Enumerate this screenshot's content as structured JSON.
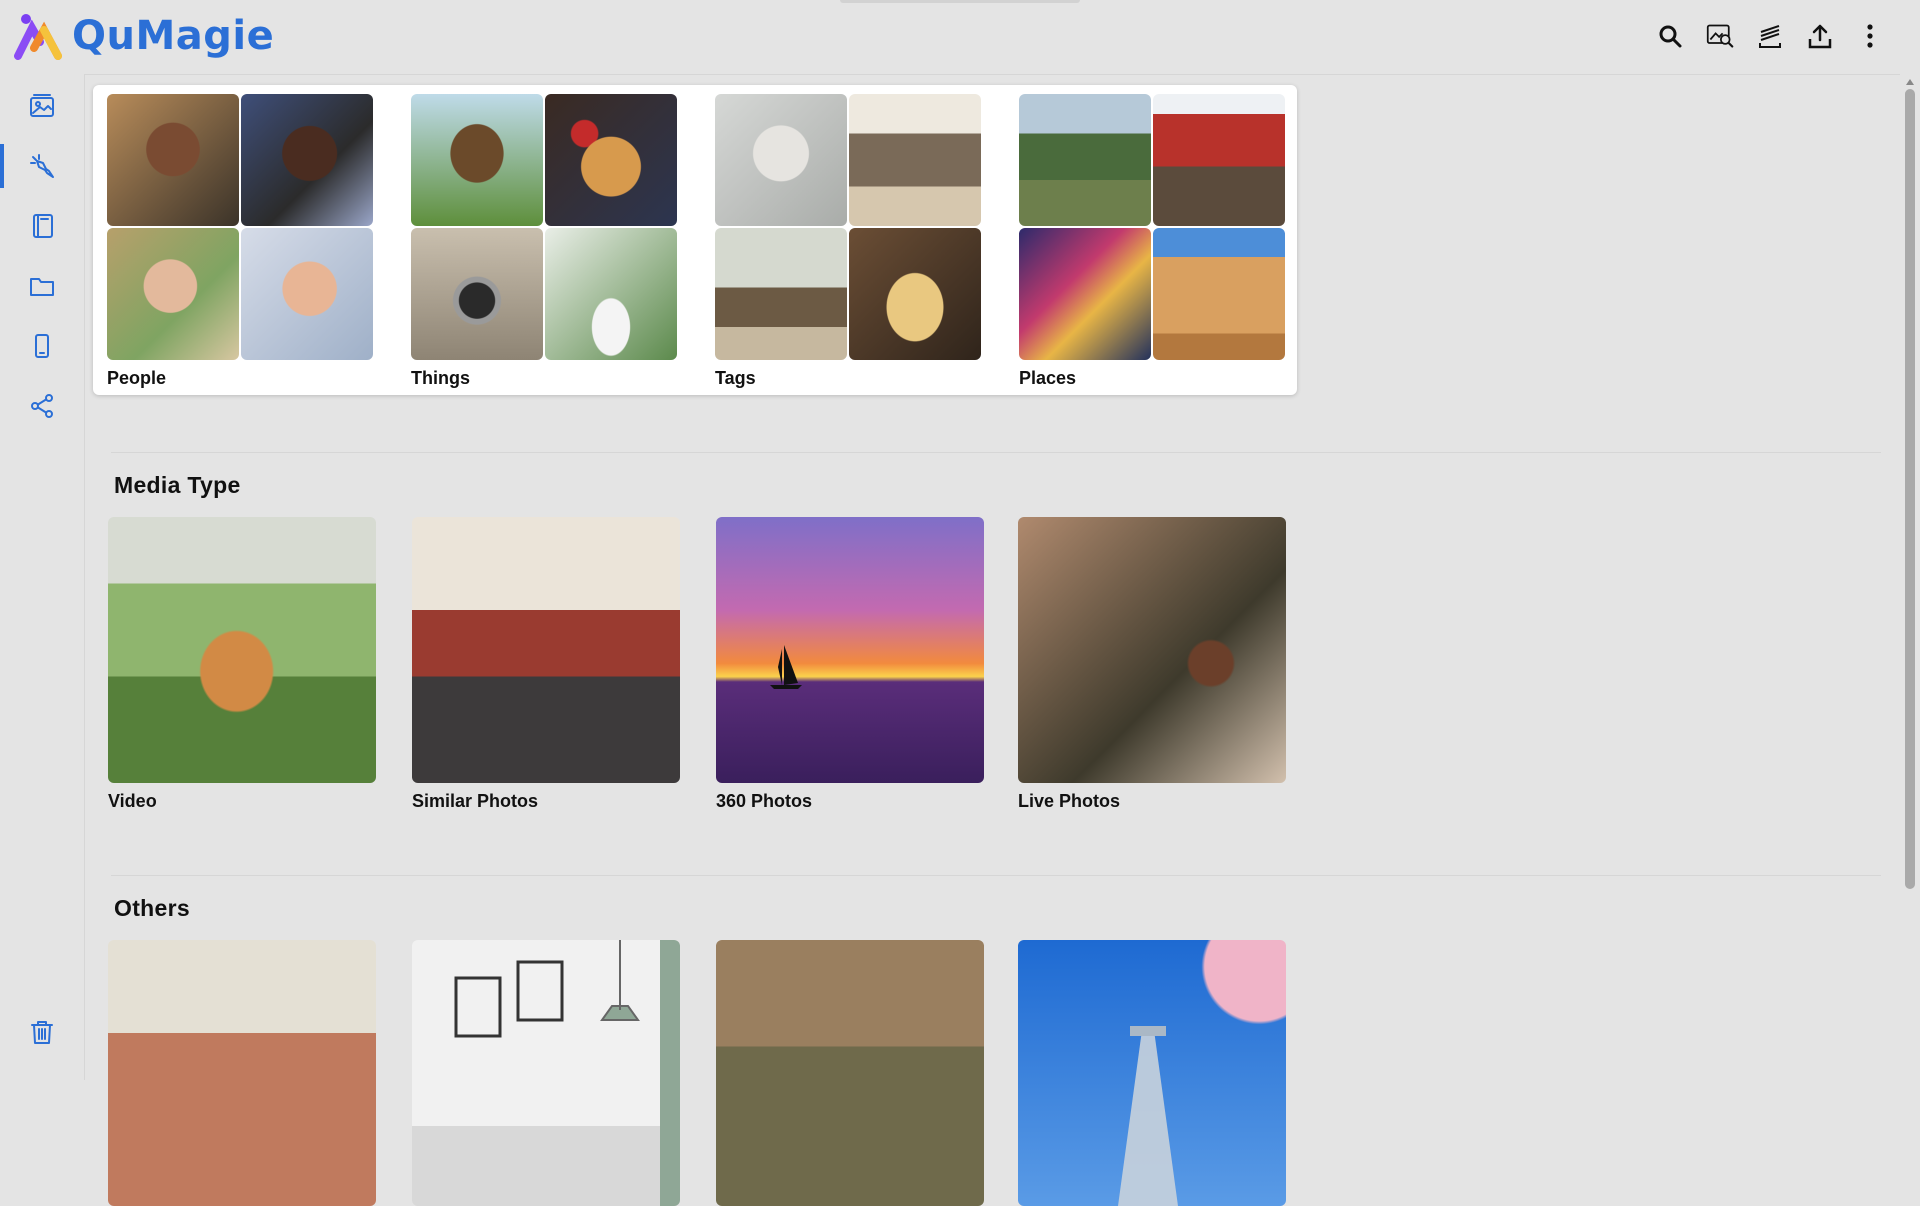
{
  "app": {
    "name": "QuMagie"
  },
  "top_actions": [
    {
      "icon": "search-icon"
    },
    {
      "icon": "image-search-icon"
    },
    {
      "icon": "stack-icon"
    },
    {
      "icon": "upload-icon"
    },
    {
      "icon": "more-vertical-icon"
    }
  ],
  "sidebar": {
    "active": "ai-icon",
    "items": [
      {
        "icon": "photos-icon"
      },
      {
        "icon": "ai-icon"
      },
      {
        "icon": "album-icon"
      },
      {
        "icon": "folder-icon"
      },
      {
        "icon": "device-icon"
      },
      {
        "icon": "share-icon"
      }
    ],
    "bottom": {
      "icon": "trash-icon"
    }
  },
  "categories": [
    {
      "label": "People"
    },
    {
      "label": "Things"
    },
    {
      "label": "Tags"
    },
    {
      "label": "Places"
    }
  ],
  "media_type": {
    "title": "Media Type",
    "items": [
      {
        "label": "Video"
      },
      {
        "label": "Similar Photos"
      },
      {
        "label": "360 Photos"
      },
      {
        "label": "Live Photos"
      }
    ]
  },
  "others": {
    "title": "Others",
    "items": [
      {
        "label": ""
      },
      {
        "label": ""
      },
      {
        "label": ""
      },
      {
        "label": ""
      }
    ]
  },
  "colors": {
    "accent": "#2b6fd6",
    "background": "#e4e4e4"
  }
}
